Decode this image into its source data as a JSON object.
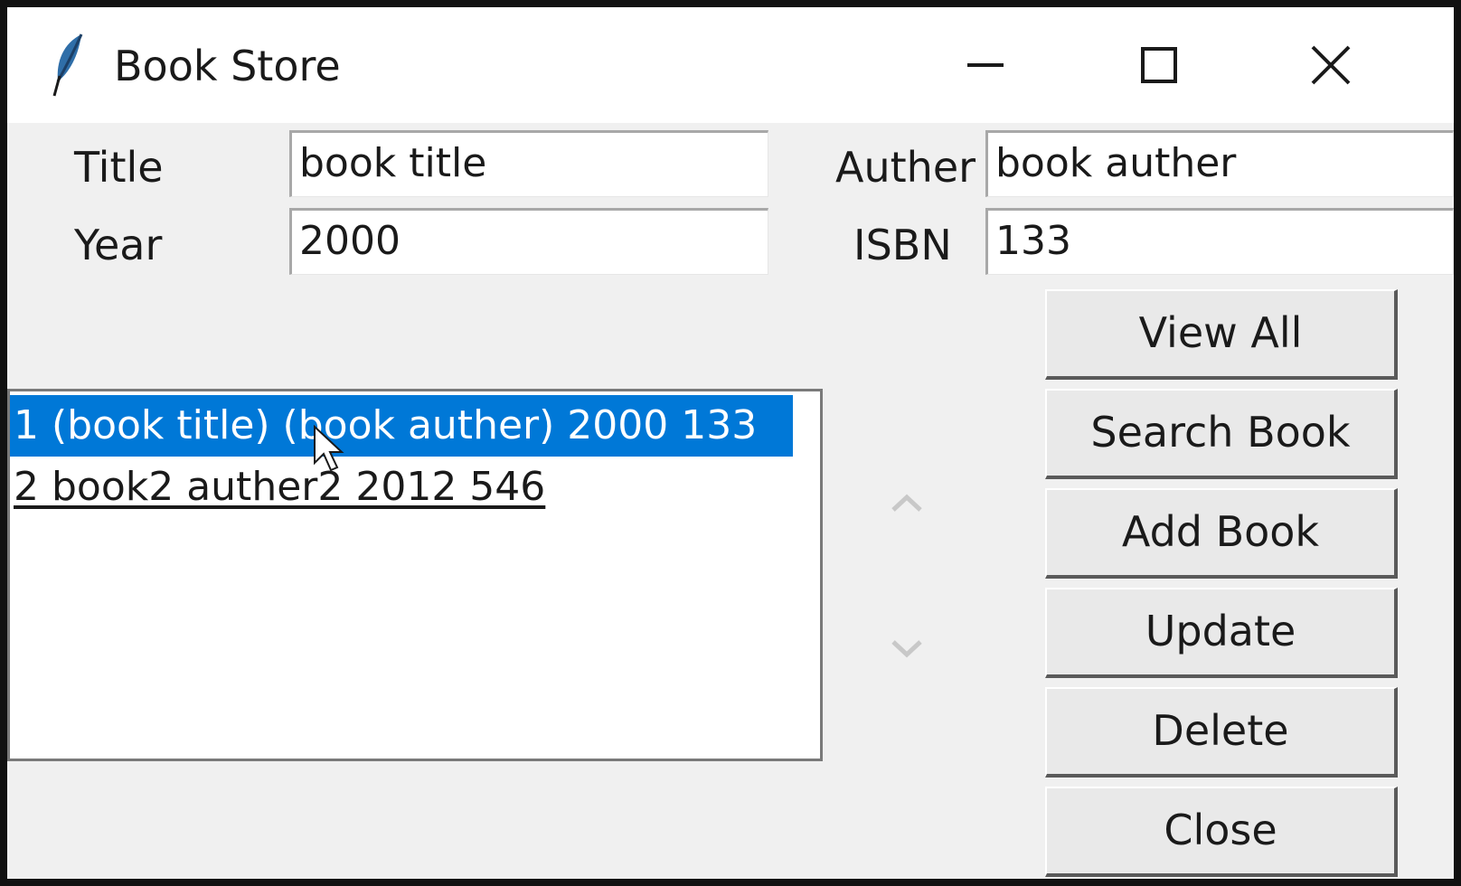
{
  "window": {
    "title": "Book Store",
    "icon": "feather-icon",
    "controls": [
      "minimize-icon",
      "maximize-icon",
      "close-icon"
    ]
  },
  "form": {
    "title_label": "Title",
    "title_value": "book title",
    "author_label": "Auther",
    "author_value": "book auther",
    "year_label": "Year",
    "year_value": "2000",
    "isbn_label": "ISBN",
    "isbn_value": "133"
  },
  "list": {
    "items": [
      "1 (book title) (book auther) 2000 133",
      "2 book2 auther2 2012 546"
    ],
    "selected_index": 0,
    "selection_color": "#0078d7"
  },
  "buttons": {
    "view_all": "View All",
    "search": "Search Book",
    "add": "Add Book",
    "update": "Update",
    "delete": "Delete",
    "close": "Close"
  }
}
